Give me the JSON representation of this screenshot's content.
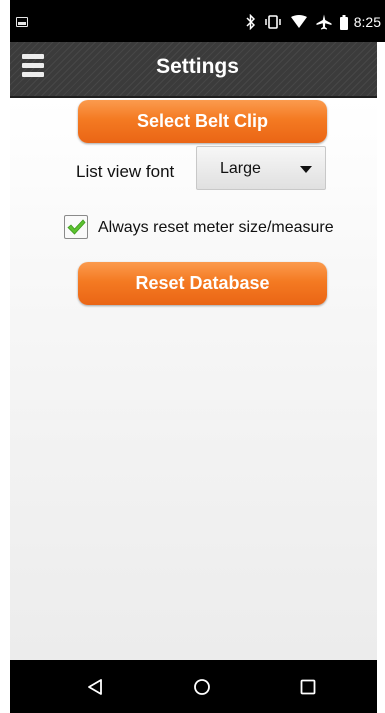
{
  "status_bar": {
    "time": "8:25",
    "icons": [
      "image-notification-icon",
      "bluetooth-icon",
      "vibrate-icon",
      "wifi-icon",
      "airplane-icon",
      "battery-icon"
    ]
  },
  "action_bar": {
    "title": "Settings",
    "menu_icon": "hamburger-menu-icon"
  },
  "settings": {
    "belt_clip_label": "Select Belt Clip",
    "list_view_font_label": "List view font",
    "list_view_font_value": "Large",
    "always_reset_label": "Always reset meter size/measure",
    "always_reset_checked": true,
    "reset_database_label": "Reset Database"
  },
  "nav_bar": {
    "icons": [
      "back-icon",
      "home-icon",
      "recents-icon"
    ]
  },
  "colors": {
    "accent_orange": "#f47a22",
    "action_bar": "#3b3b3b",
    "check_green": "#5cc230"
  }
}
